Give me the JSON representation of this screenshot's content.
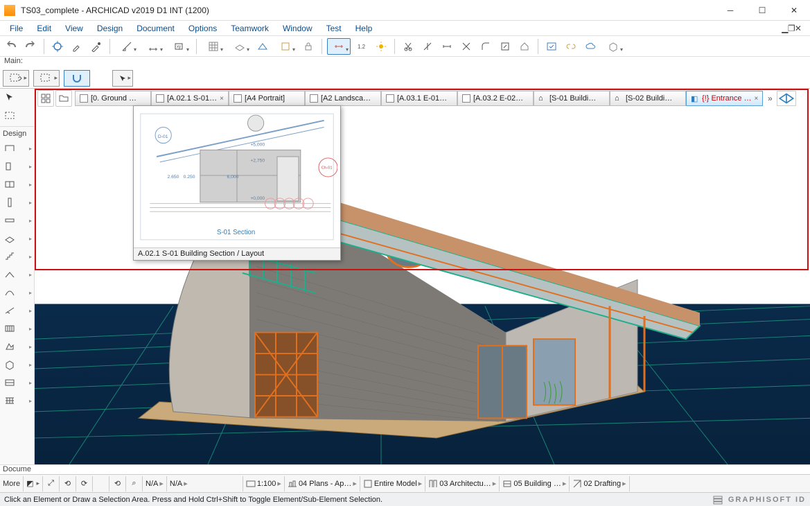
{
  "window": {
    "title": "TS03_complete - ARCHICAD v2019 D1 INT (1200)"
  },
  "menu": {
    "file": "File",
    "edit": "Edit",
    "view": "View",
    "design": "Design",
    "document": "Document",
    "options": "Options",
    "teamwork": "Teamwork",
    "window": "Window",
    "test": "Test",
    "help": "Help"
  },
  "labels": {
    "main": "Main:",
    "docume": "Docume",
    "design": "Design",
    "more": "More"
  },
  "tabs": [
    {
      "label": "[0. Ground …",
      "active": false
    },
    {
      "label": "[A.02.1 S-01…",
      "active": false,
      "closeable": true
    },
    {
      "label": "[A4 Portrait]",
      "active": false
    },
    {
      "label": "[A2 Landsca…",
      "active": false
    },
    {
      "label": "[A.03.1 E-01…",
      "active": false
    },
    {
      "label": "[A.03.2 E-02…",
      "active": false
    },
    {
      "label": "[S-01 Buildi…",
      "active": false
    },
    {
      "label": "[S-02 Buildi…",
      "active": false
    },
    {
      "label": "{!} Entrance …",
      "active": true,
      "closeable": true,
      "mod": true
    }
  ],
  "preview": {
    "caption": "A.02.1 S-01 Building Section / Layout",
    "subtitle": "S-01 Section",
    "dims": {
      "a": "2.650",
      "b": "0.250",
      "c": "6,000",
      "d": "+5,000",
      "e": "+2,750",
      "f": "+0,000"
    },
    "callouts": {
      "left": "D-01",
      "right": "Ch-01"
    }
  },
  "bottombar": {
    "na1": "N/A",
    "na2": "N/A",
    "scale": "1:100",
    "seg1": "04 Plans - Ap…",
    "seg2": "Entire Model",
    "seg3": "03  Architectu…",
    "seg4": "05  Building …",
    "seg5": "02 Drafting"
  },
  "status": {
    "hint": "Click an Element or Draw a Selection Area. Press and Hold Ctrl+Shift to Toggle Element/Sub-Element Selection.",
    "brand": "GRAPHISOFT ID"
  }
}
